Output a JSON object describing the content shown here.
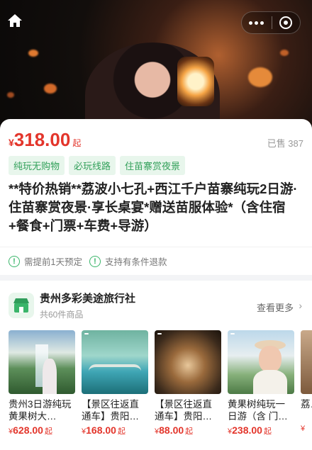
{
  "product": {
    "price_symbol": "¥",
    "price": "318.00",
    "price_suffix": "起",
    "sold": "已售 387",
    "tags": [
      "纯玩无购物",
      "必玩线路",
      "住苗寨赏夜景"
    ],
    "title": "**特价热销**荔波小七孔+西江千户苗寨纯玩2日游·住苗寨赏夜景·享长桌宴*赠送苗服体验*（含住宿+餐食+门票+车费+导游）",
    "notices": [
      "需提前1天预定",
      "支持有条件退款"
    ]
  },
  "shop": {
    "name": "贵州多彩美途旅行社",
    "count": "共60件商品",
    "more": "查看更多"
  },
  "products": [
    {
      "name": "贵州3日游纯玩黄果树大…",
      "symbol": "¥",
      "price": "628.00",
      "suffix": "起"
    },
    {
      "name": "【景区往返直通车】贵阳…",
      "symbol": "¥",
      "price": "168.00",
      "suffix": "起"
    },
    {
      "name": "【景区往返直通车】贵阳…",
      "symbol": "¥",
      "price": "88.00",
      "suffix": "起"
    },
    {
      "name": "黄果树纯玩一日游（含 门…",
      "symbol": "¥",
      "price": "238.00",
      "suffix": "起"
    },
    {
      "name": "荔…",
      "symbol": "¥",
      "price": "",
      "suffix": ""
    }
  ],
  "colors": {
    "accent": "#e3352b",
    "tag_green": "#32a05a"
  }
}
